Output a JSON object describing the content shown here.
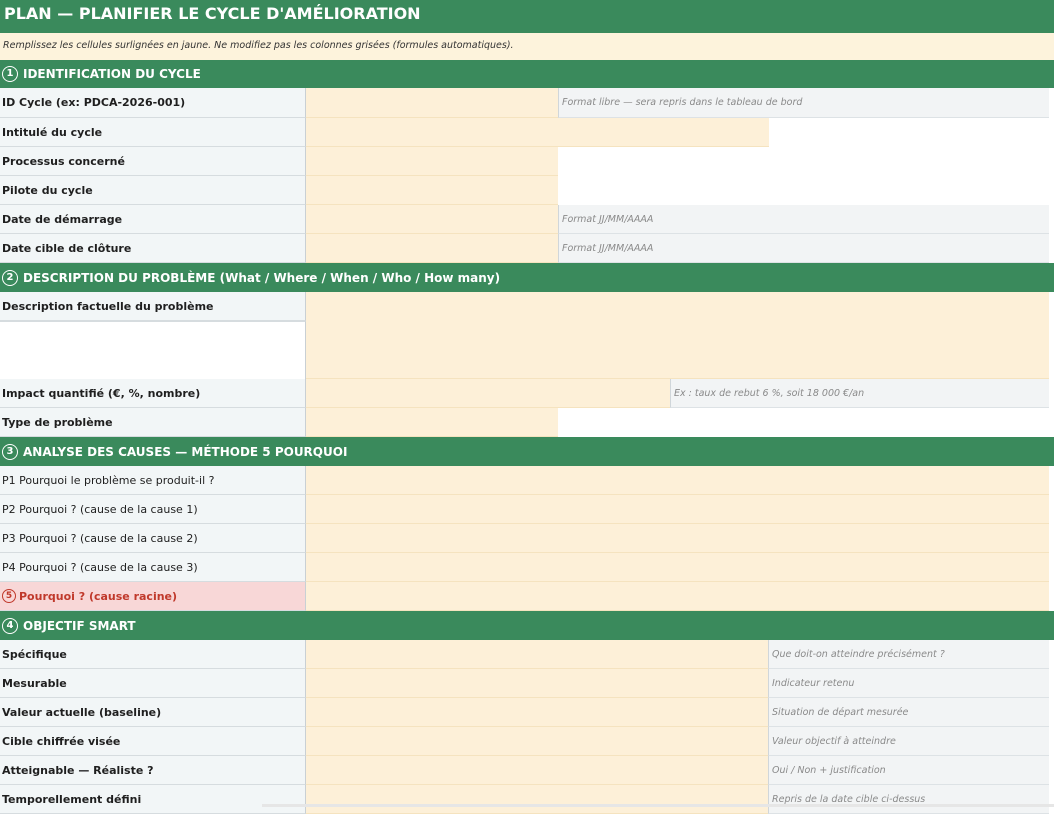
{
  "title": "PLAN — PLANIFIER LE CYCLE D'AMÉLIORATION",
  "instructions": "Remplissez les cellules surlignées en jaune. Ne modifiez pas les colonnes grisées (formules automatiques).",
  "sections": {
    "s1": {
      "num": "1",
      "title": "IDENTIFICATION DU CYCLE"
    },
    "s2": {
      "num": "2",
      "title": "DESCRIPTION DU PROBLÈME (What / Where / When / Who / How many)"
    },
    "s3": {
      "num": "3",
      "title": "ANALYSE DES CAUSES — MÉTHODE 5 POURQUOI"
    },
    "s4": {
      "num": "4",
      "title": "OBJECTIF SMART"
    }
  },
  "rows": {
    "id_cycle": {
      "label": "ID Cycle (ex: PDCA-2026-001)",
      "hint": "Format libre — sera repris dans le tableau de bord"
    },
    "intitule": {
      "label": "Intitulé du cycle"
    },
    "processus": {
      "label": "Processus concerné"
    },
    "pilote": {
      "label": "Pilote du cycle"
    },
    "date_demarrage": {
      "label": "Date de démarrage",
      "hint": "Format JJ/MM/AAAA"
    },
    "date_cloture": {
      "label": "Date cible de clôture",
      "hint": "Format JJ/MM/AAAA"
    },
    "description": {
      "label": "Description factuelle du problème"
    },
    "impact": {
      "label": "Impact quantifié (€, %, nombre)",
      "hint": "Ex : taux de rebut 6 %, soit 18 000 €/an"
    },
    "type": {
      "label": "Type de problème"
    },
    "p1": {
      "label": "P1 Pourquoi le problème se produit-il ?"
    },
    "p2": {
      "label": "P2 Pourquoi ? (cause de la cause 1)"
    },
    "p3": {
      "label": "P3 Pourquoi ? (cause de la cause 2)"
    },
    "p4": {
      "label": "P4 Pourquoi ? (cause de la cause 3)"
    },
    "p5": {
      "num": "5",
      "label": "Pourquoi ? (cause racine)"
    },
    "specifique": {
      "label": "Spécifique",
      "hint": "Que doit-on atteindre précisément ?"
    },
    "mesurable": {
      "label": "Mesurable",
      "hint": "Indicateur retenu"
    },
    "baseline": {
      "label": "Valeur actuelle (baseline)",
      "hint": "Situation de départ mesurée"
    },
    "cible": {
      "label": "Cible chiffrée visée",
      "hint": "Valeur objectif à atteindre"
    },
    "atteignable": {
      "label": "Atteignable — Réaliste ?",
      "hint": "Oui / Non + justification"
    },
    "temporel": {
      "label": "Temporellement défini",
      "hint": "Repris de la date cible ci-dessus"
    }
  }
}
